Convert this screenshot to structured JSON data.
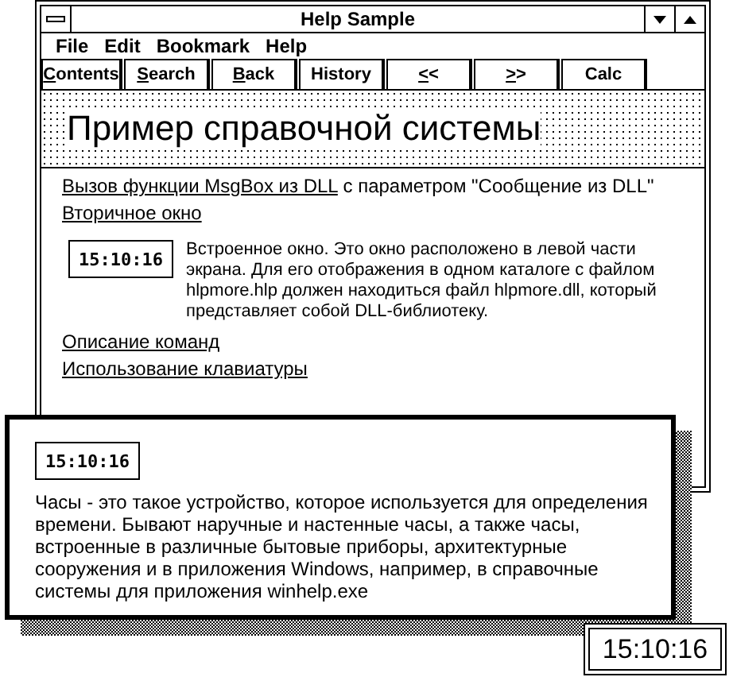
{
  "window": {
    "title": "Help Sample"
  },
  "menu": [
    "File",
    "Edit",
    "Bookmark",
    "Help"
  ],
  "buttons": [
    {
      "label": "Contents",
      "underline_first": true
    },
    {
      "label": "Search",
      "underline_first": true
    },
    {
      "label": "Back",
      "underline_first": true
    },
    {
      "label": "History",
      "underline_first": false
    },
    {
      "label": "<<",
      "underline_first": true
    },
    {
      "label": ">>",
      "underline_first": true
    },
    {
      "label": "Calc",
      "underline_first": false
    }
  ],
  "topic_title": "Пример справочной системы",
  "content": [
    {
      "kind": "link_line",
      "link": "Вызов функции MsgBox из DLL",
      "text": " с параметром \"Сообщение из DLL\""
    },
    {
      "kind": "link",
      "link": "Вторичное окно"
    },
    {
      "kind": "embedded",
      "time": "15:10:16",
      "text": "Встроенное окно. Это окно расположено в левой части экрана. Для его отображения в одном каталоге с файлом hlpmore.hlp должен находиться файл hlpmore.dll, который представляет собой DLL-библиотеку."
    },
    {
      "kind": "link",
      "link": "Описание команд"
    },
    {
      "kind": "link",
      "link": "Использование клавиатуры"
    }
  ],
  "popup": {
    "time": "15:10:16",
    "text": "Часы - это такое устройство, которое используется для определения времени. Бывают наручные и настенные часы, а также часы, встроенные в различные бытовые приборы, архитектурные сооружения и в приложения Windows, например, в справочные системы для приложения winhelp.exe"
  },
  "clock_window": {
    "time": "15:10:16"
  }
}
